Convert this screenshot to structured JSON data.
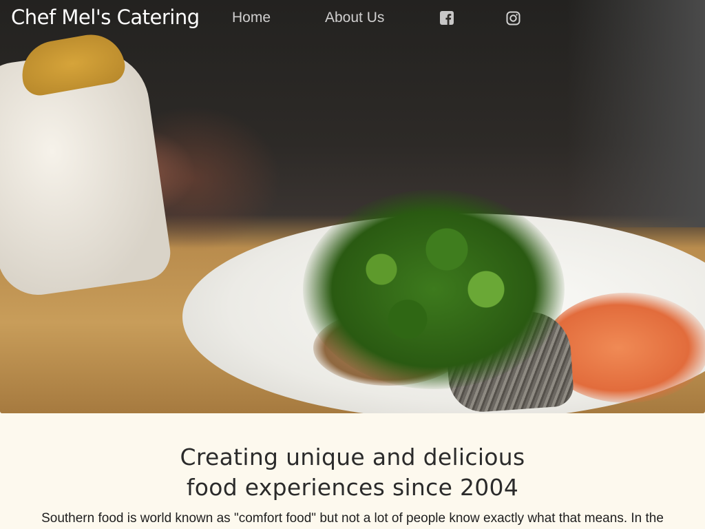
{
  "header": {
    "brand": "Chef Mel's Catering",
    "nav": [
      {
        "label": "Home"
      },
      {
        "label": "About Us"
      }
    ],
    "social": [
      {
        "icon": "facebook-icon"
      },
      {
        "icon": "instagram-icon"
      }
    ]
  },
  "hero": {
    "image": "chef-plating-dish-photo"
  },
  "main": {
    "headline_line1": "Creating unique and delicious",
    "headline_line2": "food experiences since 2004",
    "lead": "Southern food is world known as \"comfort food\" but not a lot of people know exactly what that means. In the"
  },
  "colors": {
    "background": "#fdf9ee",
    "text": "#2b2b2b",
    "nav_text": "#ffffff"
  }
}
